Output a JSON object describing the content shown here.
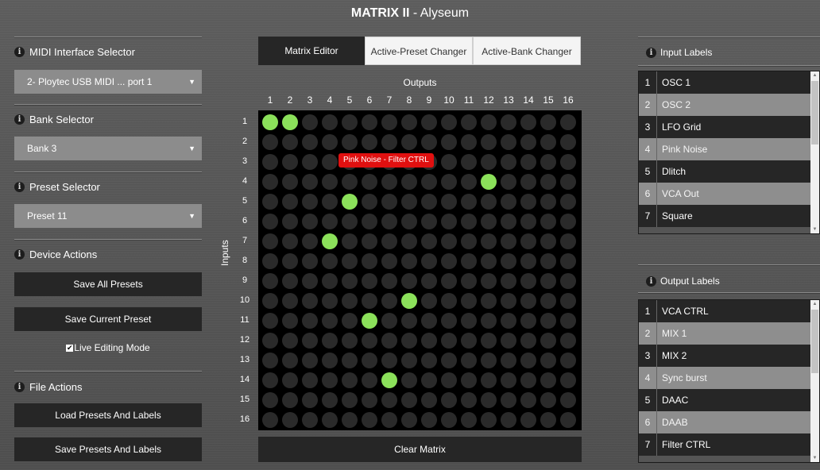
{
  "title": {
    "bold": "MATRIX II",
    "rest": " - Alyseum"
  },
  "left": {
    "midi": {
      "header": "MIDI Interface Selector",
      "value": "2- Ploytec USB MIDI ... port 1"
    },
    "bank": {
      "header": "Bank Selector",
      "value": "Bank 3"
    },
    "preset": {
      "header": "Preset Selector",
      "value": "Preset 11"
    },
    "device": {
      "header": "Device Actions",
      "save_all": "Save All Presets",
      "save_current": "Save Current Preset",
      "live_editing": "Live Editing Mode",
      "live_checked": true
    },
    "file": {
      "header": "File Actions",
      "load": "Load Presets And Labels",
      "save": "Save Presets And Labels"
    }
  },
  "tabs": [
    "Matrix Editor",
    "Active-Preset Changer",
    "Active-Bank Changer"
  ],
  "matrix": {
    "outputs_label": "Outputs",
    "inputs_label": "Inputs",
    "columns": [
      "1",
      "2",
      "3",
      "4",
      "5",
      "6",
      "7",
      "8",
      "9",
      "10",
      "11",
      "12",
      "13",
      "14",
      "15",
      "16"
    ],
    "rows": [
      "1",
      "2",
      "3",
      "4",
      "5",
      "6",
      "7",
      "8",
      "9",
      "10",
      "11",
      "12",
      "13",
      "14",
      "15",
      "16"
    ],
    "active": [
      [
        1,
        1
      ],
      [
        1,
        2
      ],
      [
        4,
        12
      ],
      [
        5,
        5
      ],
      [
        7,
        4
      ],
      [
        10,
        8
      ],
      [
        11,
        6
      ],
      [
        14,
        7
      ]
    ],
    "tooltip": "Pink Noise - Filter CTRL",
    "clear_label": "Clear Matrix"
  },
  "input_labels": {
    "header": "Input Labels",
    "items": [
      {
        "n": "1",
        "label": "OSC 1"
      },
      {
        "n": "2",
        "label": "OSC 2"
      },
      {
        "n": "3",
        "label": "LFO Grid"
      },
      {
        "n": "4",
        "label": "Pink Noise"
      },
      {
        "n": "5",
        "label": "Dlitch"
      },
      {
        "n": "6",
        "label": "VCA Out"
      },
      {
        "n": "7",
        "label": "Square"
      }
    ]
  },
  "output_labels": {
    "header": "Output Labels",
    "items": [
      {
        "n": "1",
        "label": "VCA CTRL"
      },
      {
        "n": "2",
        "label": "MIX 1"
      },
      {
        "n": "3",
        "label": "MIX 2"
      },
      {
        "n": "4",
        "label": "Sync burst"
      },
      {
        "n": "5",
        "label": "DAAC"
      },
      {
        "n": "6",
        "label": "DAAB"
      },
      {
        "n": "7",
        "label": "Filter CTRL"
      }
    ]
  },
  "colors": {
    "led_on": "#8be05a",
    "led_off": "#2a2a2a",
    "tooltip": "#e01010"
  }
}
